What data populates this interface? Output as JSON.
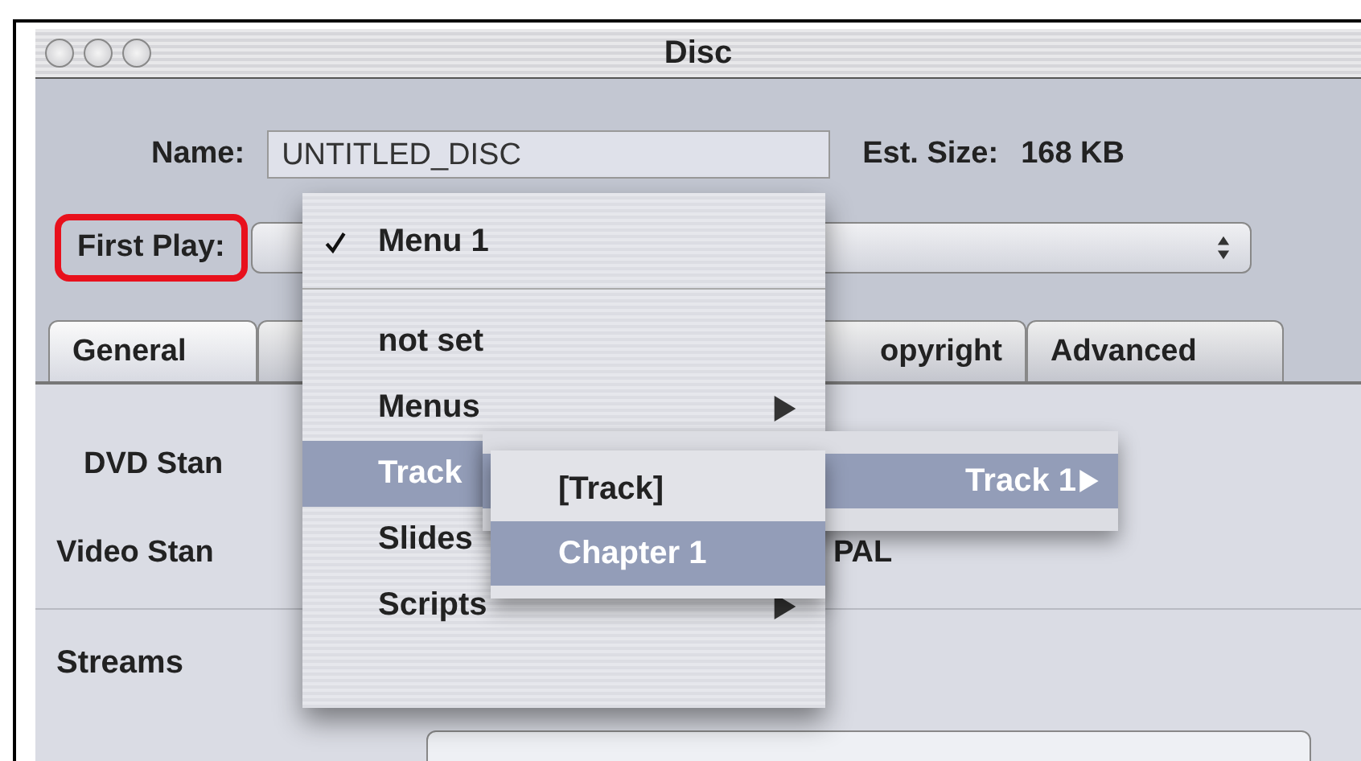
{
  "window": {
    "title": "Disc"
  },
  "name_field": {
    "label": "Name:",
    "value": "UNTITLED_DISC"
  },
  "est_size": {
    "label": "Est. Size:",
    "value": "168 KB"
  },
  "first_play": {
    "label": "First Play:",
    "highlighted": true
  },
  "tabs": [
    {
      "label": "General",
      "selected": true
    },
    {
      "selected": false
    },
    {
      "label": "opyright",
      "selected": false
    },
    {
      "label": "Advanced",
      "selected": false
    }
  ],
  "settings": [
    {
      "label": "DVD Stan"
    },
    {
      "label": "Video Stan",
      "value": "PAL"
    }
  ],
  "section": "Streams",
  "menu": {
    "items": [
      {
        "kind": "item",
        "label": "Menu 1",
        "checked": true,
        "submenu": false,
        "selected": false
      },
      {
        "kind": "separator"
      },
      {
        "kind": "item",
        "label": "not set",
        "checked": false,
        "submenu": false,
        "selected": false
      },
      {
        "kind": "item",
        "label": "Menus",
        "checked": false,
        "submenu": true,
        "selected": false
      },
      {
        "kind": "item",
        "label": "Track",
        "checked": false,
        "selected": true
      },
      {
        "kind": "item",
        "label": "Slides",
        "checked": false,
        "selected": false
      },
      {
        "kind": "item",
        "label": "Scripts",
        "checked": false,
        "submenu": true,
        "selected": false
      }
    ]
  },
  "track_submenu": {
    "items": [
      {
        "label": "Track 1",
        "submenu": true,
        "selected": true
      }
    ]
  },
  "chapter_submenu": {
    "items": [
      {
        "label": "[Track]",
        "selected": false
      },
      {
        "label": "Chapter 1",
        "selected": true
      }
    ]
  }
}
